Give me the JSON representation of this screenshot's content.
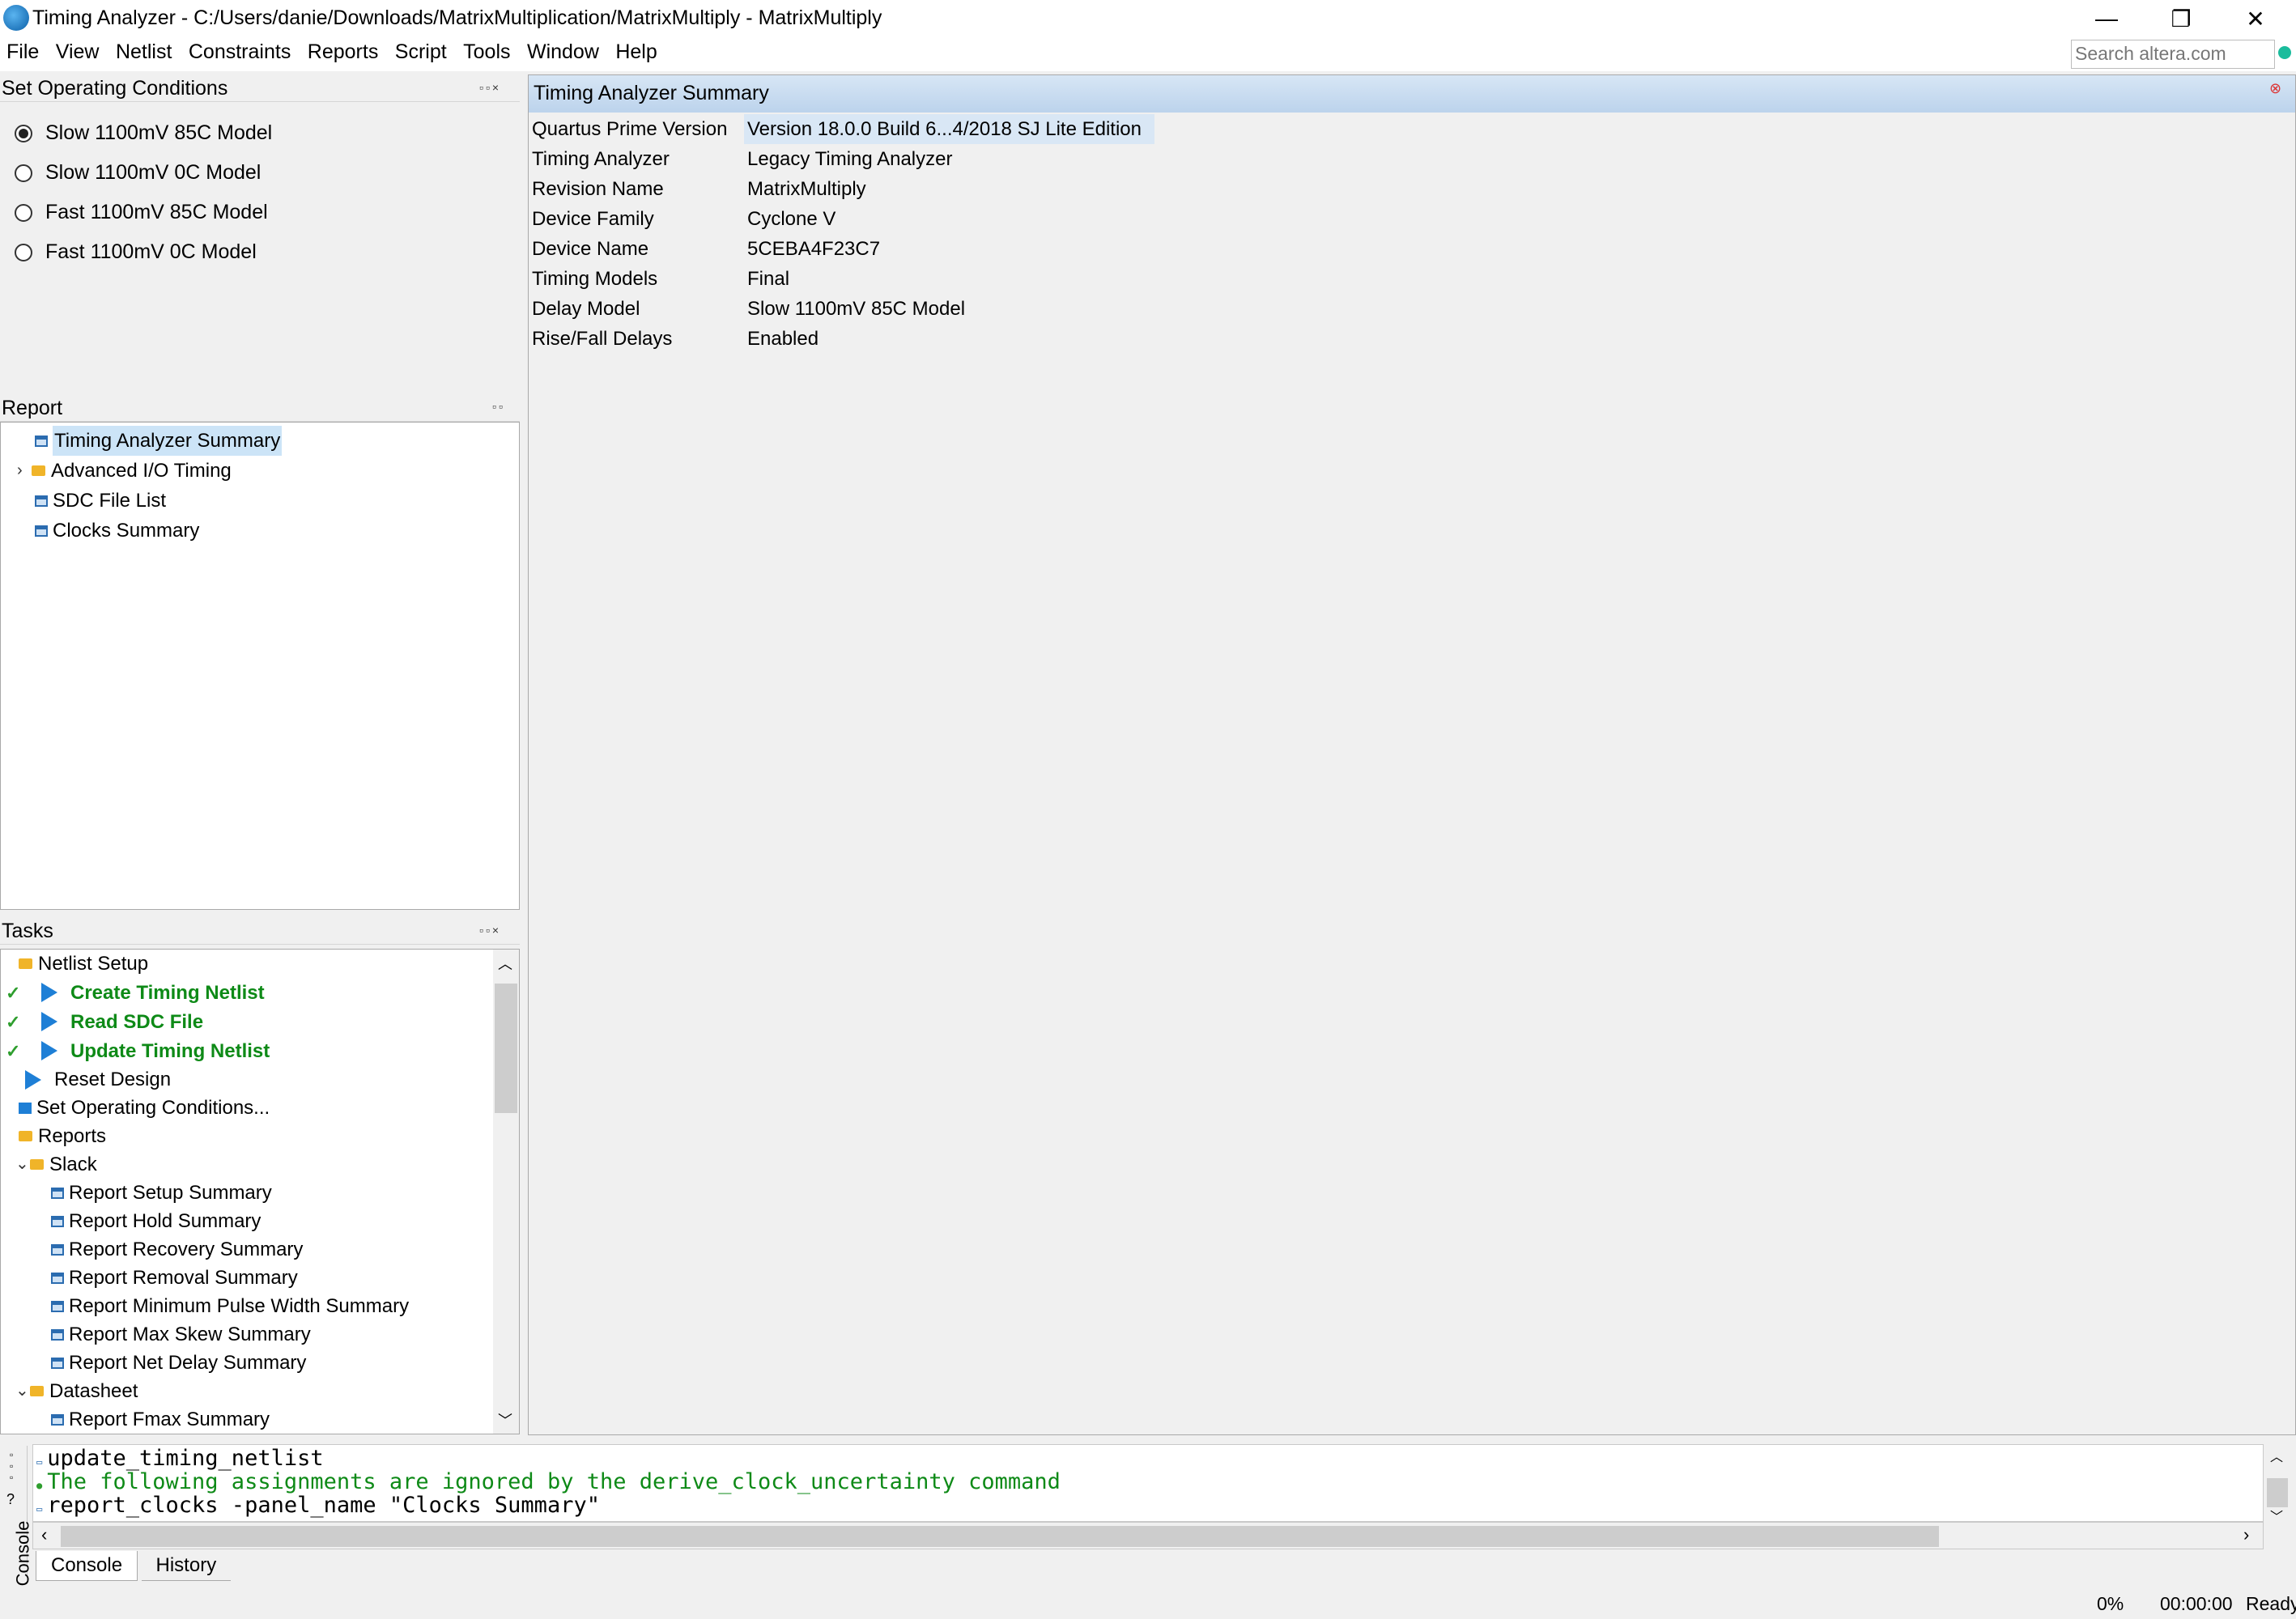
{
  "window": {
    "title": "Timing Analyzer - C:/Users/danie/Downloads/MatrixMultiplication/MatrixMultiply - MatrixMultiply",
    "minimize_glyph": "—",
    "restore_glyph": "❐",
    "close_glyph": "✕"
  },
  "menu": {
    "items": [
      "File",
      "View",
      "Netlist",
      "Constraints",
      "Reports",
      "Script",
      "Tools",
      "Window",
      "Help"
    ],
    "search_placeholder": "Search altera.com"
  },
  "operating_conditions": {
    "title": "Set Operating Conditions",
    "options": [
      {
        "label": "Slow 1100mV 85C Model",
        "selected": true
      },
      {
        "label": "Slow 1100mV 0C Model",
        "selected": false
      },
      {
        "label": "Fast 1100mV 85C Model",
        "selected": false
      },
      {
        "label": "Fast 1100mV 0C Model",
        "selected": false
      }
    ]
  },
  "report": {
    "title": "Report",
    "items": [
      {
        "label": "Timing Analyzer Summary",
        "selected": true
      },
      {
        "label": "Advanced I/O Timing",
        "folder": true
      },
      {
        "label": "SDC File List"
      },
      {
        "label": "Clocks Summary"
      }
    ]
  },
  "tasks": {
    "title": "Tasks",
    "items": [
      {
        "label": "Netlist Setup"
      },
      {
        "label": "Create Timing Netlist"
      },
      {
        "label": "Read SDC File"
      },
      {
        "label": "Update Timing Netlist"
      },
      {
        "label": "Reset Design"
      },
      {
        "label": "Set Operating Conditions..."
      },
      {
        "label": "Reports"
      },
      {
        "label": "Slack"
      },
      {
        "label": "Report Setup Summary"
      },
      {
        "label": "Report Hold Summary"
      },
      {
        "label": "Report Recovery Summary"
      },
      {
        "label": "Report Removal Summary"
      },
      {
        "label": "Report Minimum Pulse Width Summary"
      },
      {
        "label": "Report Max Skew Summary"
      },
      {
        "label": "Report Net Delay Summary"
      },
      {
        "label": "Datasheet"
      },
      {
        "label": "Report Fmax Summary"
      }
    ]
  },
  "summary": {
    "title": "Timing Analyzer Summary",
    "rows": [
      {
        "key": "Quartus Prime Version",
        "value": "Version 18.0.0 Build 6...4/2018 SJ Lite Edition"
      },
      {
        "key": "Timing Analyzer",
        "value": "Legacy Timing Analyzer"
      },
      {
        "key": "Revision Name",
        "value": "MatrixMultiply"
      },
      {
        "key": "Device Family",
        "value": "Cyclone V"
      },
      {
        "key": "Device Name",
        "value": "5CEBA4F23C7"
      },
      {
        "key": "Timing Models",
        "value": "Final"
      },
      {
        "key": "Delay Model",
        "value": "Slow 1100mV 85C Model"
      },
      {
        "key": "Rise/Fall Delays",
        "value": "Enabled"
      }
    ]
  },
  "console": {
    "label": "Console",
    "lines": [
      {
        "text": "update_timing_netlist",
        "color": "#000000"
      },
      {
        "text": "The following assignments are ignored by the derive_clock_uncertainty command",
        "color": "#0e8a17"
      },
      {
        "text": "report_clocks -panel_name \"Clocks Summary\"",
        "color": "#000000"
      }
    ],
    "tabs": [
      "Console",
      "History"
    ]
  },
  "status": {
    "progress": "0%",
    "time": "00:00:00",
    "state": "Ready"
  }
}
